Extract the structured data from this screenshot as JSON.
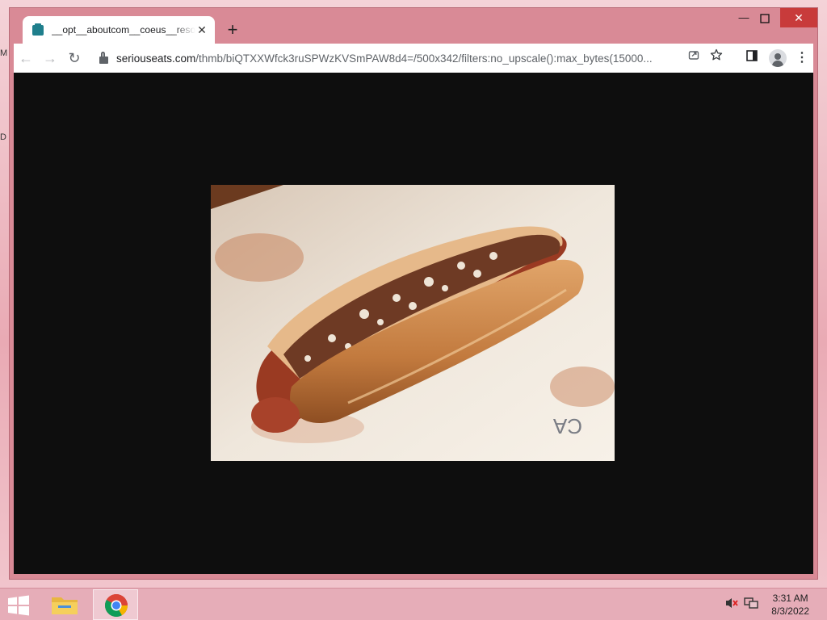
{
  "desktop": {
    "edge_letters": [
      "M",
      "D"
    ]
  },
  "browser": {
    "tab": {
      "title": "__opt__aboutcom__coeus__resou",
      "close_glyph": "✕"
    },
    "new_tab_glyph": "+",
    "window_controls": {
      "minimize": "—",
      "maximize": "☐",
      "close": "✕"
    },
    "nav": {
      "back_glyph": "←",
      "forward_glyph": "→",
      "reload_glyph": "↻"
    },
    "address_bar": {
      "domain": "seriouseats.com",
      "path": "/thmb/biQTXXWfck3ruSPWzKVSmPAW8d4=/500x342/filters:no_upscale():max_bytes(15000..."
    },
    "icons": [
      "share-icon",
      "bookmark-star-icon",
      "side-panel-icon",
      "profile-icon",
      "menu-icon"
    ],
    "colors": {
      "frame": "#d98a96",
      "viewport_bg": "#0e0e0e",
      "tab_icon": "#1f7f8c"
    }
  },
  "taskbar": {
    "apps": [
      "file-explorer",
      "chrome"
    ],
    "tray_icons": [
      "volume-muted-icon",
      "network-icon"
    ],
    "time": "3:31 AM",
    "date": "8/3/2022"
  }
}
